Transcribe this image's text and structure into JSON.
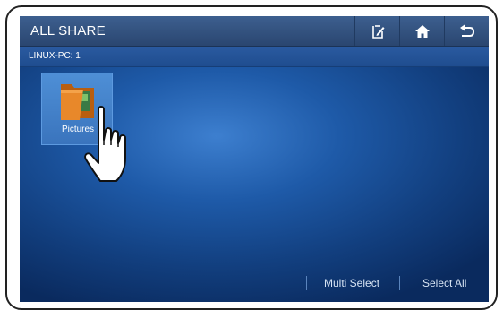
{
  "header": {
    "title": "ALL SHARE",
    "buttons": [
      {
        "icon": "edit-icon"
      },
      {
        "icon": "home-icon"
      },
      {
        "icon": "back-icon"
      }
    ]
  },
  "path": {
    "label": "LINUX-PC: 1"
  },
  "items": [
    {
      "label": "Pictures",
      "icon": "folder-icon"
    }
  ],
  "footer": {
    "multi_select": "Multi Select",
    "select_all": "Select All"
  },
  "colors": {
    "background": "#1e5aa8",
    "topbar": "#2a4670",
    "folder": "#e8882a"
  }
}
